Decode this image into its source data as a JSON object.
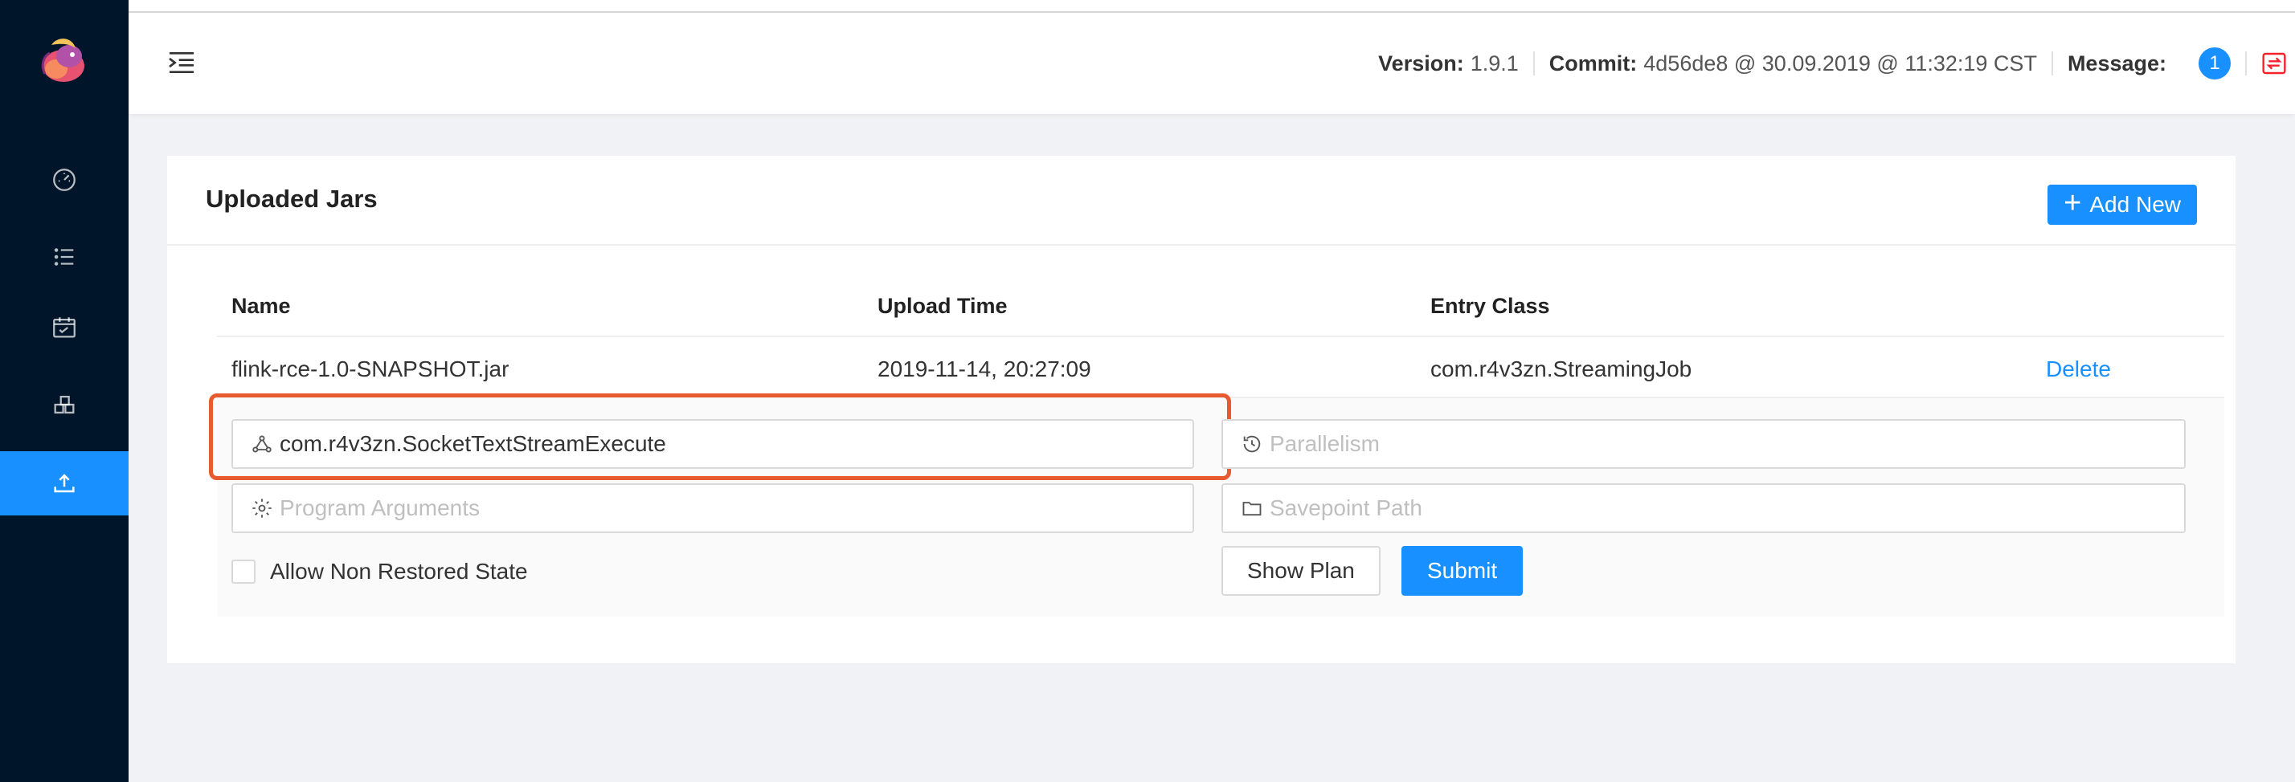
{
  "header": {
    "version_label": "Version:",
    "version_value": "1.9.1",
    "commit_label": "Commit:",
    "commit_value": "4d56de8 @ 30.09.2019 @ 11:32:19 CST",
    "message_label": "Message:",
    "message_count": "1"
  },
  "sidebar": {
    "items": [
      {
        "icon": "dashboard-icon",
        "active": false
      },
      {
        "icon": "list-icon",
        "active": false
      },
      {
        "icon": "schedule-icon",
        "active": false
      },
      {
        "icon": "cluster-icon",
        "active": false
      },
      {
        "icon": "upload-icon",
        "active": true
      }
    ]
  },
  "card": {
    "title": "Uploaded Jars",
    "add_button": "Add New"
  },
  "table": {
    "columns": [
      "Name",
      "Upload Time",
      "Entry Class"
    ],
    "rows": [
      {
        "name": "flink-rce-1.0-SNAPSHOT.jar",
        "upload_time": "2019-11-14, 20:27:09",
        "entry_class": "com.r4v3zn.StreamingJob",
        "action": "Delete"
      }
    ]
  },
  "form": {
    "entry_class_value": "com.r4v3zn.SocketTextStreamExecute",
    "parallelism_placeholder": "Parallelism",
    "program_args_placeholder": "Program Arguments",
    "savepoint_placeholder": "Savepoint Path",
    "allow_non_restored_label": "Allow Non Restored State",
    "allow_non_restored_checked": false,
    "show_plan_label": "Show Plan",
    "submit_label": "Submit"
  },
  "colors": {
    "accent": "#1890ff",
    "sidebar_bg": "#001529",
    "highlight": "#e85a2f"
  }
}
